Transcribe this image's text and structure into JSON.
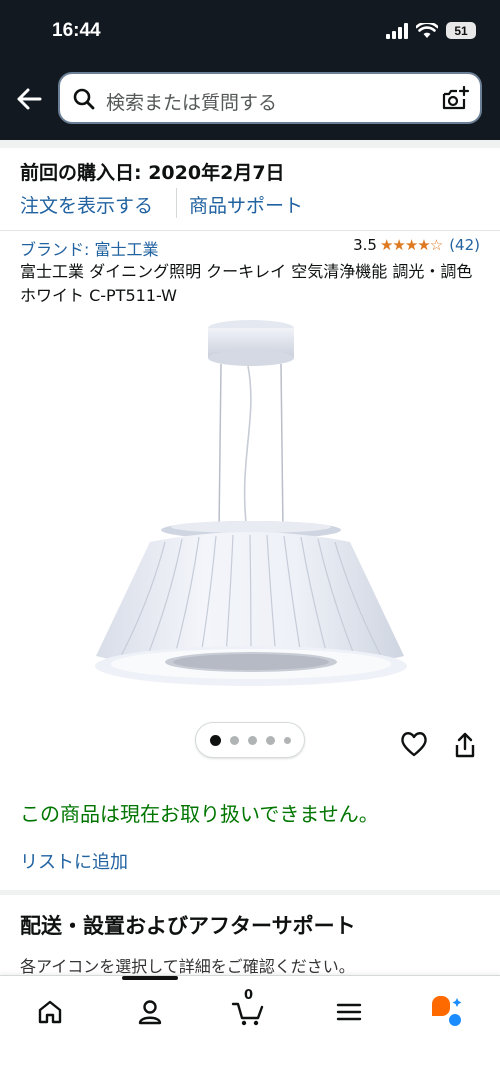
{
  "status_bar": {
    "time": "16:44",
    "battery": "51"
  },
  "search": {
    "placeholder": "検索または質問する"
  },
  "purchase": {
    "previous_purchase": "前回の購入日: 2020年2月7日",
    "view_order": "注文を表示する",
    "product_support": "商品サポート"
  },
  "product": {
    "brand": "ブランド: 富士工業",
    "rating": "3.5",
    "stars": "★★★★☆",
    "rating_count": "(42)",
    "title": "富士工業 ダイニング照明 クーキレイ 空気清浄機能 調光・調色 ホワイト C-PT511-W",
    "image_dots": 5,
    "availability": "この商品は現在お取り扱いできません。",
    "add_to_list": "リストに追加"
  },
  "delivery": {
    "heading": "配送・設置およびアフターサポート",
    "note": "各アイコンを選択して詳細をご確認ください。"
  },
  "bottom_nav": {
    "items": [
      "home-icon",
      "account-icon",
      "cart-icon",
      "menu-icon",
      "assistant-icon"
    ],
    "cart_count": "0"
  },
  "colors": {
    "header": "#131921",
    "link": "#2162a1",
    "unavailable": "#007600",
    "star": "#de7921"
  }
}
